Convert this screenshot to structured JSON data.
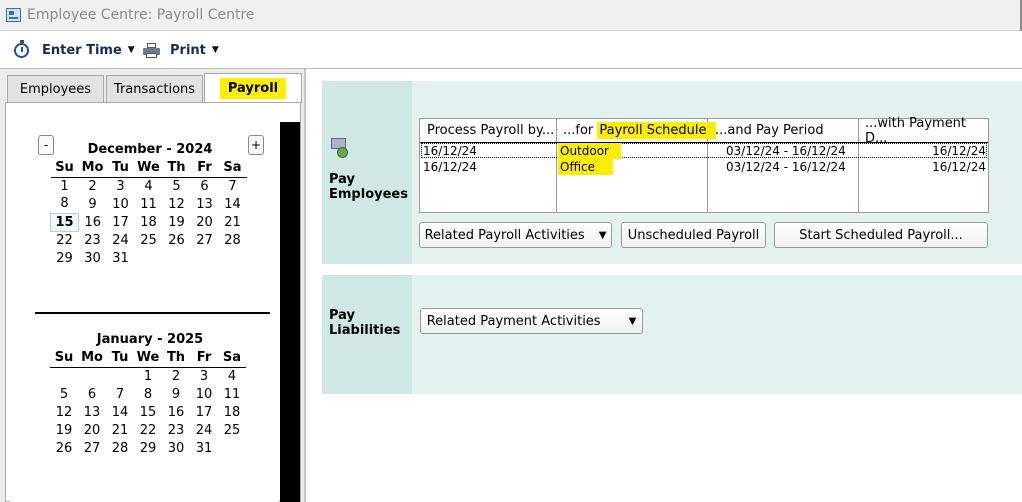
{
  "window": {
    "title": "Employee Centre: Payroll Centre"
  },
  "toolbar": {
    "enter_time_label": "Enter Time",
    "print_label": "Print"
  },
  "tabs": [
    {
      "label": "Employees"
    },
    {
      "label": "Transactions"
    },
    {
      "label": "Payroll"
    }
  ],
  "calendar": {
    "prev_label": "-",
    "next_label": "+",
    "weekdays": [
      "Su",
      "Mo",
      "Tu",
      "We",
      "Th",
      "Fr",
      "Sa"
    ],
    "months": [
      {
        "title": "December - 2024",
        "weeks": [
          [
            "1",
            "2",
            "3",
            "4",
            "5",
            "6",
            "7"
          ],
          [
            "8",
            "9",
            "10",
            "11",
            "12",
            "13",
            "14"
          ],
          [
            "15",
            "16",
            "17",
            "18",
            "19",
            "20",
            "21"
          ],
          [
            "22",
            "23",
            "24",
            "25",
            "26",
            "27",
            "28"
          ],
          [
            "29",
            "30",
            "31",
            "",
            "",
            "",
            ""
          ]
        ],
        "today": "15"
      },
      {
        "title": "January - 2025",
        "weeks": [
          [
            "",
            "",
            "",
            "1",
            "2",
            "3",
            "4"
          ],
          [
            "5",
            "6",
            "7",
            "8",
            "9",
            "10",
            "11"
          ],
          [
            "12",
            "13",
            "14",
            "15",
            "16",
            "17",
            "18"
          ],
          [
            "19",
            "20",
            "21",
            "22",
            "23",
            "24",
            "25"
          ],
          [
            "26",
            "27",
            "28",
            "29",
            "30",
            "31",
            ""
          ]
        ]
      }
    ]
  },
  "pay_employees": {
    "name": "Pay Employees",
    "name_line1": "Pay",
    "name_line2": "Employees",
    "table": {
      "headers": [
        "Process Payroll by...",
        "...for Payroll Schedule",
        "...and Pay Period",
        "...with Payment D..."
      ],
      "header_schedule_prefix": "...for ",
      "header_schedule_hl": "Payroll Schedule",
      "rows": [
        {
          "process_by": "16/12/24",
          "schedule": "Outdoor",
          "period": "03/12/24 - 16/12/24",
          "payment_date": "16/12/24"
        },
        {
          "process_by": "16/12/24",
          "schedule": "Office",
          "period": "03/12/24 - 16/12/24",
          "payment_date": "16/12/24"
        }
      ]
    },
    "buttons": {
      "related": "Related Payroll Activities",
      "unscheduled": "Unscheduled Payroll",
      "start": "Start Scheduled Payroll..."
    }
  },
  "pay_liabilities": {
    "name_line1": "Pay",
    "name_line2": "Liabilities",
    "buttons": {
      "related": "Related Payment Activities"
    }
  },
  "colors": {
    "highlight": "#ffee00",
    "section_bg": "#e3f1ef",
    "section_side": "#cfe8e5"
  }
}
